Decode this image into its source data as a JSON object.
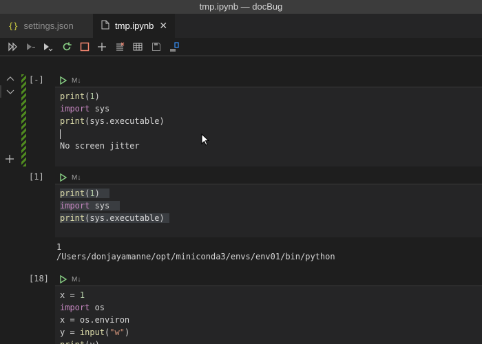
{
  "window": {
    "title": "tmp.ipynb — docBug"
  },
  "tabs": [
    {
      "label": "settings.json",
      "icon": "json-icon",
      "icon_glyph": "{}"
    },
    {
      "label": "tmp.ipynb",
      "icon": "notebook-file-icon",
      "close_glyph": "✕"
    }
  ],
  "toolbar": {
    "buttons": [
      "run-all-icon",
      "run-above-icon",
      "run-below-icon",
      "restart-kernel-icon",
      "interrupt-icon",
      "add-cell-icon",
      "clear-outputs-icon",
      "variables-icon",
      "save-icon",
      "export-icon"
    ]
  },
  "cells": [
    {
      "count": "[-]",
      "kind_label": "M↓",
      "lines": [
        "print(1)",
        "import sys",
        "print(sys.executable)",
        "",
        "No screen jitter"
      ]
    },
    {
      "count": "[1]",
      "kind_label": "M↓",
      "lines": [
        "print(1)",
        "import sys",
        "print(sys.executable)"
      ],
      "output": [
        "1",
        "/Users/donjayamanne/opt/miniconda3/envs/env01/bin/python"
      ]
    },
    {
      "count": "[18]",
      "kind_label": "M↓",
      "lines": [
        "x = 1",
        "import os",
        "x = os.environ",
        "y = input(\"w\")",
        "print(y)"
      ]
    }
  ],
  "colors": {
    "background": "#1e1e1e",
    "focus_bar": "#4f8a1f",
    "keyword": "#c586c0",
    "function": "#dcdcaa",
    "string": "#ce9178",
    "run_button": "#89d185"
  }
}
